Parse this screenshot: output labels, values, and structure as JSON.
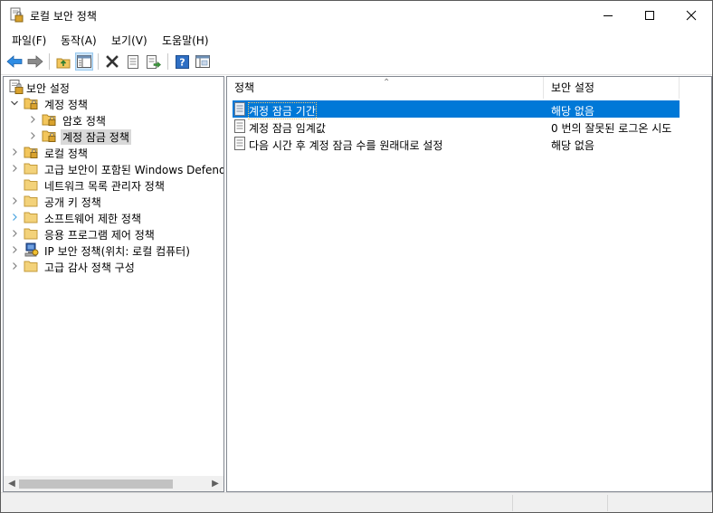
{
  "window": {
    "title": "로컬 보안 정책"
  },
  "menu": [
    {
      "label": "파일(F)"
    },
    {
      "label": "동작(A)"
    },
    {
      "label": "보기(V)"
    },
    {
      "label": "도움말(H)"
    }
  ],
  "toolbar": {
    "icons": [
      "back-arrow-icon",
      "forward-arrow-icon",
      "up-folder-icon",
      "show-tree-icon",
      "delete-icon",
      "properties-icon",
      "export-list-icon",
      "help-icon",
      "console-icon"
    ]
  },
  "tree": {
    "root": "보안 설정",
    "items": [
      {
        "label": "계정 정책"
      },
      {
        "label": "암호 정책"
      },
      {
        "label": "계정 잠금 정책"
      },
      {
        "label": "로컬 정책"
      },
      {
        "label": "고급 보안이 포함된 Windows Defender 방화벽"
      },
      {
        "label": "네트워크 목록 관리자 정책"
      },
      {
        "label": "공개 키 정책"
      },
      {
        "label": "소프트웨어 제한 정책"
      },
      {
        "label": "응용 프로그램 제어 정책"
      },
      {
        "label": "IP 보안 정책(위치: 로컬 컴퓨터)"
      },
      {
        "label": "고급 감사 정책 구성"
      }
    ]
  },
  "list": {
    "columns": [
      "정책",
      "보안 설정"
    ],
    "rows": [
      {
        "name": "계정 잠금 기간",
        "value": "해당 없음"
      },
      {
        "name": "계정 잠금 임계값",
        "value": "0 번의 잘못된 로그온 시도"
      },
      {
        "name": "다음 시간 후 계정 잠금 수를 원래대로 설정",
        "value": "해당 없음"
      }
    ]
  },
  "colors": {
    "selection": "#0078d7",
    "tree_selection": "#d9d9d9",
    "folder": "#f3c65c"
  }
}
